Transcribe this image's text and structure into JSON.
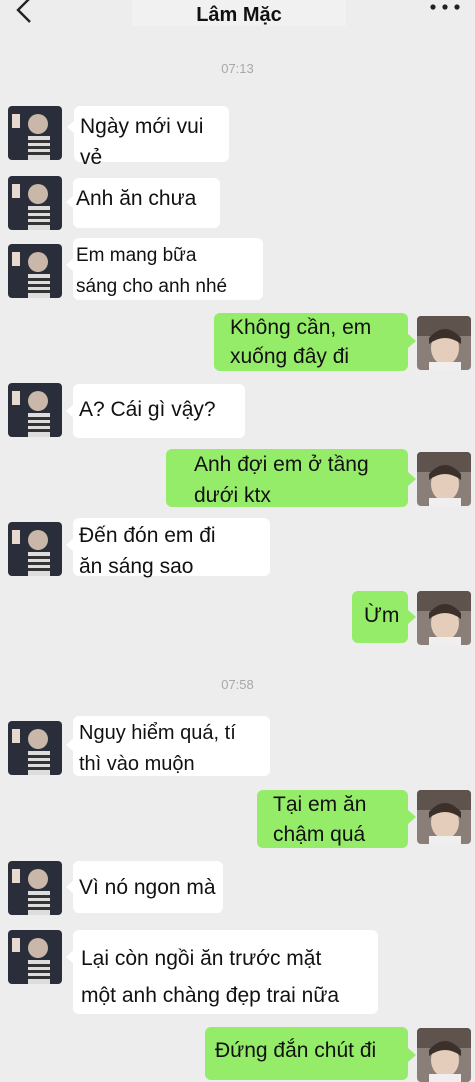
{
  "header": {
    "title": "Lâm Mặc",
    "back_icon": "chevron-left-icon",
    "more_icon": "more-dots-icon"
  },
  "colors": {
    "background": "#ededed",
    "incoming_bubble": "#ffffff",
    "outgoing_bubble": "#95ec69",
    "timestamp": "#a8a8a8"
  },
  "timestamps": [
    "07:13",
    "07:58"
  ],
  "messages": [
    {
      "side": "in",
      "text": "Ngày mới vui\nvẻ"
    },
    {
      "side": "in",
      "text": "Anh ăn chưa"
    },
    {
      "side": "in",
      "text": "Em mang bữa\nsáng cho anh nhé"
    },
    {
      "side": "out",
      "text": "Không cần, em\nxuống đây đi"
    },
    {
      "side": "in",
      "text": "A? Cái gì vậy?"
    },
    {
      "side": "out",
      "text": "Anh đợi em ở tầng\ndưới ktx"
    },
    {
      "side": "in",
      "text": "Đến đón em đi\năn sáng sao"
    },
    {
      "side": "out",
      "text": "Ừm"
    },
    {
      "side": "in",
      "text": "Nguy hiểm quá, tí\nthì vào muộn"
    },
    {
      "side": "out",
      "text": "Tại em ăn\nchậm quá"
    },
    {
      "side": "in",
      "text": "Vì nó ngon mà"
    },
    {
      "side": "in",
      "text": "Lại còn ngồi ăn trước mặt\nmột anh chàng đẹp trai nữa"
    },
    {
      "side": "out",
      "text": "Đứng đắn chút đi"
    }
  ]
}
